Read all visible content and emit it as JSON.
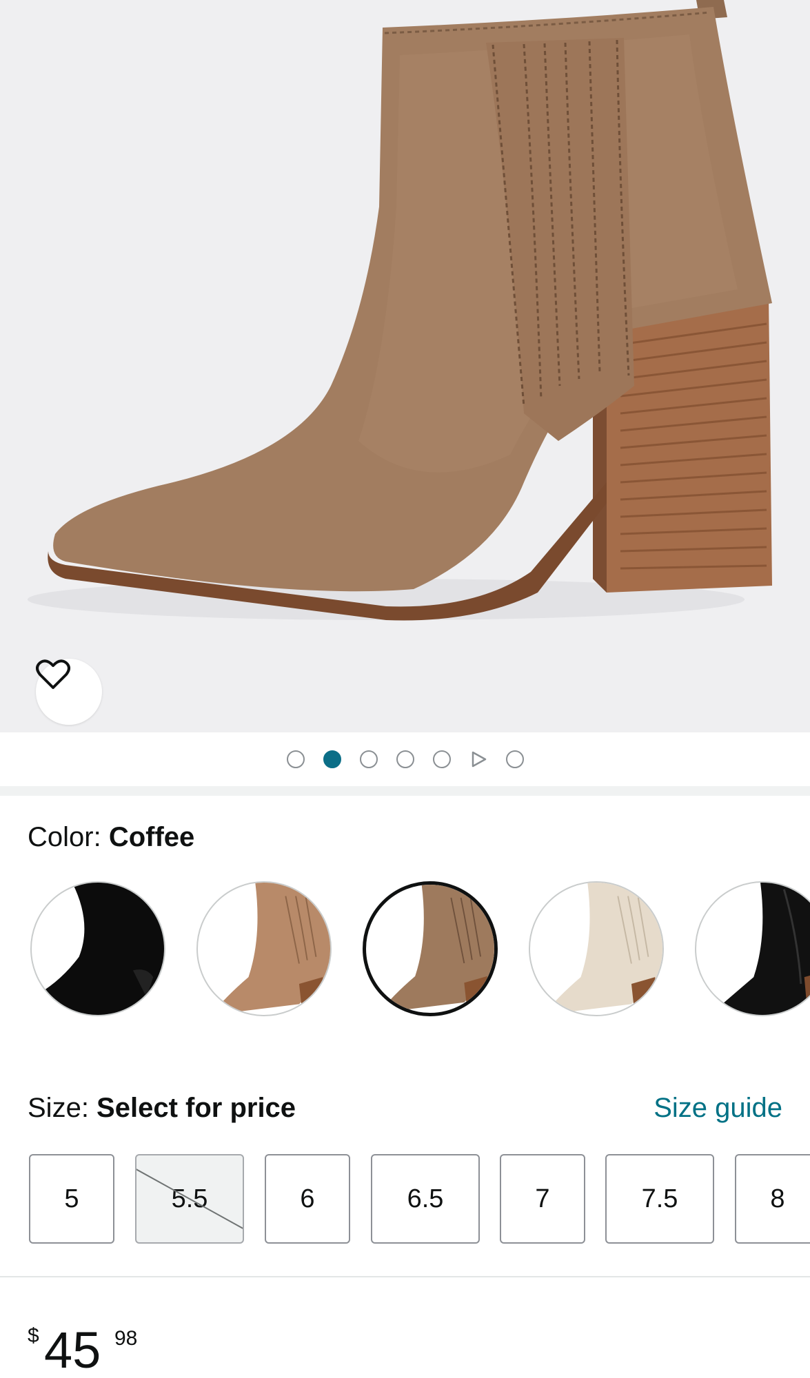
{
  "hero": {
    "favorite_icon": "heart-outline-icon"
  },
  "carousel": {
    "dots": [
      {
        "type": "image",
        "active": false
      },
      {
        "type": "image",
        "active": true
      },
      {
        "type": "image",
        "active": false
      },
      {
        "type": "image",
        "active": false
      },
      {
        "type": "image",
        "active": false
      },
      {
        "type": "video",
        "active": false
      },
      {
        "type": "image",
        "active": false
      }
    ],
    "active_color": "#0b6e87"
  },
  "color": {
    "label": "Color: ",
    "value": "Coffee",
    "swatches": [
      {
        "tone": "black suede",
        "selected": false
      },
      {
        "tone": "tan suede",
        "selected": false
      },
      {
        "tone": "coffee suede",
        "selected": true
      },
      {
        "tone": "beige suede",
        "selected": false
      },
      {
        "tone": "black leather",
        "selected": false
      }
    ]
  },
  "size": {
    "label": "Size: ",
    "value": "Select for price",
    "guide_link": "Size guide",
    "options": [
      {
        "label": "5",
        "available": true
      },
      {
        "label": "5.5",
        "available": false
      },
      {
        "label": "6",
        "available": true
      },
      {
        "label": "6.5",
        "available": true
      },
      {
        "label": "7",
        "available": true
      },
      {
        "label": "7.5",
        "available": true
      },
      {
        "label": "8",
        "available": true
      }
    ]
  },
  "price": {
    "symbol": "$",
    "whole": "45",
    "fraction": "98"
  },
  "colors": {
    "link": "#007185",
    "text": "#0f1111"
  }
}
